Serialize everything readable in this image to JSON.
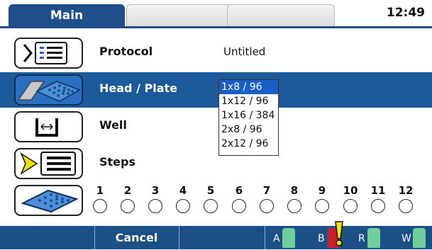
{
  "tabs": [
    {
      "label": "Main"
    },
    {
      "label": ""
    },
    {
      "label": ""
    }
  ],
  "clock": "12:49",
  "rows": [
    {
      "label": "Protocol",
      "value": "Untitled"
    },
    {
      "label": "Head / Plate",
      "value": ""
    },
    {
      "label": "Well",
      "value": ""
    },
    {
      "label": "Steps",
      "value": ""
    }
  ],
  "dropdown": {
    "options": [
      "1x8 / 96",
      "1x12 / 96",
      "1x16 / 384",
      "2x8 / 96",
      "2x12 / 96"
    ],
    "selected": "1x8 / 96"
  },
  "wells": [
    "1",
    "2",
    "3",
    "4",
    "5",
    "6",
    "7",
    "8",
    "9",
    "10",
    "11",
    "12"
  ],
  "bottom": {
    "cancel_label": "Cancel",
    "bottles": [
      {
        "label": "A",
        "color": "#6fcf9a"
      },
      {
        "label": "B",
        "color": "#c8202a",
        "alert": true
      },
      {
        "label": "R",
        "color": "#6fcf9a"
      },
      {
        "label": "W",
        "color": "#6fcf9a"
      }
    ]
  },
  "colors": {
    "accent": "#1c5a9c",
    "selection": "#1a5fc8"
  }
}
